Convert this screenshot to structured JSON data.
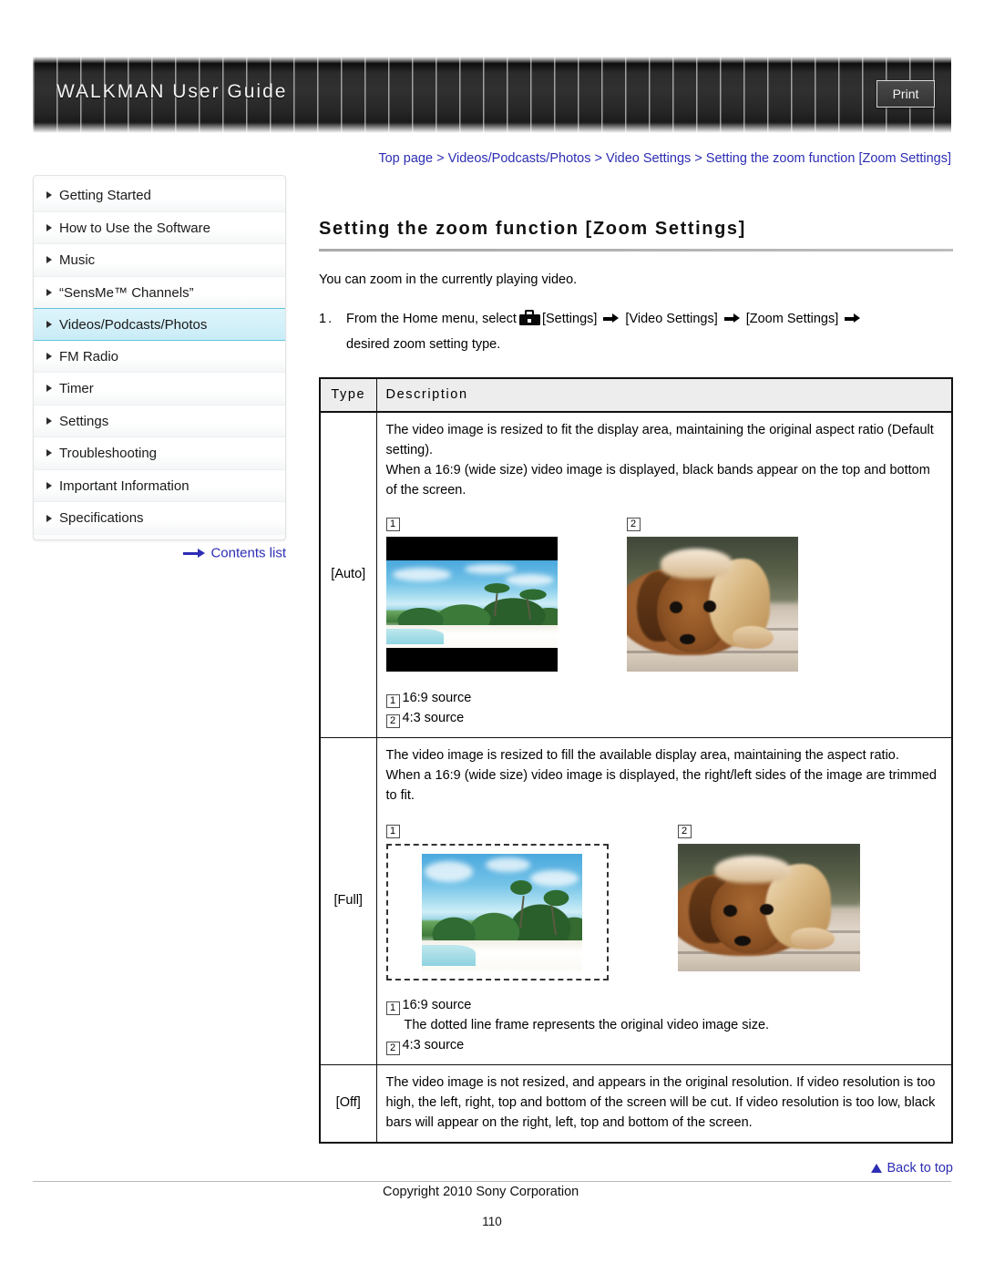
{
  "header": {
    "title": "WALKMAN User Guide",
    "print_label": "Print"
  },
  "breadcrumb": {
    "items": [
      "Top page",
      "Videos/Podcasts/Photos",
      "Video Settings",
      "Setting the zoom function [Zoom Settings]"
    ],
    "separator": ">",
    "full_text": "Top page > Videos/Podcasts/Photos > Video Settings > Setting the zoom function [Zoom Settings]"
  },
  "sidebar": {
    "items": [
      {
        "label": "Getting Started",
        "active": false
      },
      {
        "label": "How to Use the Software",
        "active": false
      },
      {
        "label": "Music",
        "active": false
      },
      {
        "label": "“SensMe™ Channels”",
        "active": false
      },
      {
        "label": "Videos/Podcasts/Photos",
        "active": true
      },
      {
        "label": "FM Radio",
        "active": false
      },
      {
        "label": "Timer",
        "active": false
      },
      {
        "label": "Settings",
        "active": false
      },
      {
        "label": "Troubleshooting",
        "active": false
      },
      {
        "label": "Important Information",
        "active": false
      },
      {
        "label": "Specifications",
        "active": false
      }
    ],
    "contents_list_label": "Contents list",
    "active_highlight_color": "#d4f0f9",
    "active_border_color": "#63c6de"
  },
  "main": {
    "page_title": "Setting the zoom function [Zoom Settings]",
    "intro": "You can zoom in the currently playing video.",
    "step": {
      "number": "1.",
      "text_before_icon": "From the Home menu, select",
      "item1": "[Settings]",
      "item2": "[Video Settings]",
      "item3": "[Zoom Settings]",
      "text_after": "desired zoom setting type."
    }
  },
  "table": {
    "headers": [
      "Type",
      "Description"
    ],
    "rows": [
      {
        "type": "[Auto]",
        "description_lines": [
          "The video image is resized to fit the display area, maintaining the original aspect ratio (Default setting).",
          "When a 16:9 (wide size) video image is displayed, black bands appear on the top and bottom of the screen."
        ],
        "figures": [
          {
            "marker": "1",
            "caption": "16:9 source",
            "style": "letterboxed-beach"
          },
          {
            "marker": "2",
            "caption": "4:3 source",
            "style": "dog"
          }
        ],
        "captions": [
          {
            "marker": "1",
            "text": "16:9 source",
            "sub": ""
          },
          {
            "marker": "2",
            "text": "4:3 source",
            "sub": ""
          }
        ]
      },
      {
        "type": "[Full]",
        "description_lines": [
          "The video image is resized to fill the available display area, maintaining the aspect ratio.",
          "When a 16:9 (wide size) video image is displayed, the right/left sides of the image are trimmed to fit."
        ],
        "figures": [
          {
            "marker": "1",
            "caption": "16:9 source",
            "style": "dashed-beach"
          },
          {
            "marker": "2",
            "caption": "4:3 source",
            "style": "dog"
          }
        ],
        "captions": [
          {
            "marker": "1",
            "text": "16:9 source",
            "sub": "The dotted line frame represents the original video image size."
          },
          {
            "marker": "2",
            "text": "4:3 source",
            "sub": ""
          }
        ]
      },
      {
        "type": "[Off]",
        "description_lines": [
          "The video image is not resized, and appears in the original resolution. If video resolution is too high, the left, right, top and bottom of the screen will be cut. If video resolution is too low, black bars will appear on the right, left, top and bottom of the screen."
        ],
        "figures": [],
        "captions": []
      }
    ]
  },
  "footer": {
    "back_to_top": "Back to top",
    "copyright": "Copyright 2010 Sony Corporation",
    "page_number": "110"
  },
  "colors": {
    "link": "#2d2db5",
    "header_bg": "#2c2c2c",
    "table_header_bg": "#ededed"
  }
}
